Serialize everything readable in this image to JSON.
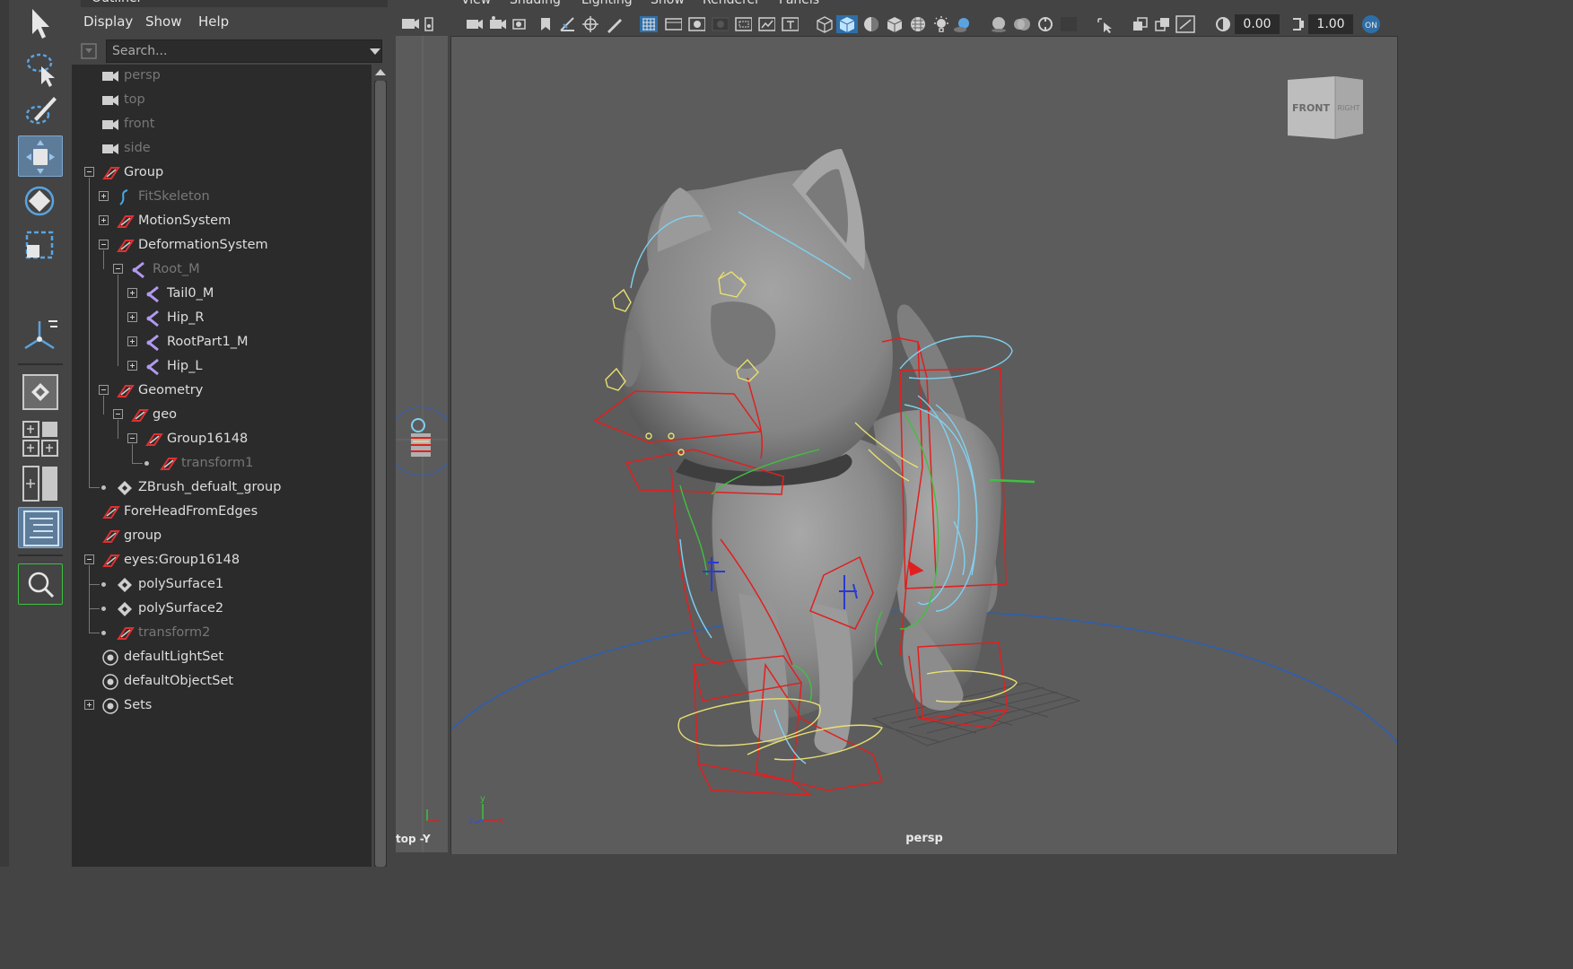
{
  "outliner": {
    "title": "Outliner",
    "menu": [
      "Display",
      "Show",
      "Help"
    ],
    "search_placeholder": "Search...",
    "rows": [
      {
        "label": "persp",
        "depth": 0,
        "icon": "camera-icon",
        "state": "dim",
        "expander": "none"
      },
      {
        "label": "top",
        "depth": 0,
        "icon": "camera-icon",
        "state": "dim",
        "expander": "none"
      },
      {
        "label": "front",
        "depth": 0,
        "icon": "camera-icon",
        "state": "dim",
        "expander": "none"
      },
      {
        "label": "side",
        "depth": 0,
        "icon": "camera-icon",
        "state": "dim",
        "expander": "none"
      },
      {
        "label": "Group",
        "depth": 0,
        "icon": "transform-icon",
        "state": "normal",
        "expander": "minus"
      },
      {
        "label": "FitSkeleton",
        "depth": 1,
        "icon": "curve-icon",
        "state": "dim",
        "expander": "plus"
      },
      {
        "label": "MotionSystem",
        "depth": 1,
        "icon": "transform-icon",
        "state": "normal",
        "expander": "plus"
      },
      {
        "label": "DeformationSystem",
        "depth": 1,
        "icon": "transform-icon",
        "state": "normal",
        "expander": "minus"
      },
      {
        "label": "Root_M",
        "depth": 2,
        "icon": "joint-icon",
        "state": "dim",
        "expander": "minus"
      },
      {
        "label": "Tail0_M",
        "depth": 3,
        "icon": "joint-icon",
        "state": "normal",
        "expander": "plus"
      },
      {
        "label": "Hip_R",
        "depth": 3,
        "icon": "joint-icon",
        "state": "normal",
        "expander": "plus"
      },
      {
        "label": "RootPart1_M",
        "depth": 3,
        "icon": "joint-icon",
        "state": "normal",
        "expander": "plus"
      },
      {
        "label": "Hip_L",
        "depth": 3,
        "icon": "joint-icon",
        "state": "normal",
        "expander": "plus"
      },
      {
        "label": "Geometry",
        "depth": 1,
        "icon": "transform-icon",
        "state": "normal",
        "expander": "minus"
      },
      {
        "label": "geo",
        "depth": 2,
        "icon": "transform-icon",
        "state": "normal",
        "expander": "minus"
      },
      {
        "label": "Group16148",
        "depth": 3,
        "icon": "transform-icon",
        "state": "normal",
        "expander": "minus"
      },
      {
        "label": "transform1",
        "depth": 4,
        "icon": "transform-icon",
        "state": "dim",
        "expander": "dot"
      },
      {
        "label": "ZBrush_defualt_group",
        "depth": 1,
        "icon": "mesh-icon",
        "state": "normal",
        "expander": "dot"
      },
      {
        "label": "ForeHeadFromEdges",
        "depth": 0,
        "icon": "transform-icon",
        "state": "normal",
        "expander": "none"
      },
      {
        "label": "group",
        "depth": 0,
        "icon": "transform-icon",
        "state": "normal",
        "expander": "none"
      },
      {
        "label": "eyes:Group16148",
        "depth": 0,
        "icon": "transform-icon",
        "state": "normal",
        "expander": "minus"
      },
      {
        "label": "polySurface1",
        "depth": 1,
        "icon": "mesh-icon",
        "state": "normal",
        "expander": "dot"
      },
      {
        "label": "polySurface2",
        "depth": 1,
        "icon": "mesh-icon",
        "state": "normal",
        "expander": "dot"
      },
      {
        "label": "transform2",
        "depth": 1,
        "icon": "transform-icon",
        "state": "dim",
        "expander": "dot"
      },
      {
        "label": "defaultLightSet",
        "depth": 0,
        "icon": "set-icon",
        "state": "normal",
        "expander": "none"
      },
      {
        "label": "defaultObjectSet",
        "depth": 0,
        "icon": "set-icon",
        "state": "normal",
        "expander": "none"
      },
      {
        "label": "Sets",
        "depth": 0,
        "icon": "set-icon",
        "state": "normal",
        "expander": "plus"
      }
    ]
  },
  "viewport": {
    "menu": [
      "View",
      "Shading",
      "Lighting",
      "Show",
      "Renderer",
      "Panels"
    ],
    "camera_label": "persp",
    "field_value_1": "0.00",
    "field_value_2": "1.00",
    "viewcube_front": "FRONT",
    "viewcube_right": "RIGHT",
    "axis_x": "x",
    "axis_y": "y",
    "axis_z": "z"
  },
  "side_view": {
    "label": "top -Y"
  },
  "toolbox": {
    "tools": [
      "select-tool-icon",
      "lasso-tool-icon",
      "paint-select-tool-icon",
      "move-tool-icon",
      "rotate-tool-icon",
      "scale-tool-icon",
      "snap-tool-icon",
      "single-perspective-layout-icon",
      "four-view-layout-icon",
      "two-pane-layout-icon",
      "outliner-layout-icon",
      "zoom-icon"
    ],
    "active_tools": [
      "move-tool-icon",
      "outliner-layout-icon"
    ]
  },
  "colors": {
    "accent": "#5d7c9a",
    "rig_red": "#e02020",
    "rig_yellow": "#e8e070",
    "rig_cyan": "#7fd0f0",
    "rig_green": "#40c040",
    "ground_circle": "#2a5fb8"
  }
}
